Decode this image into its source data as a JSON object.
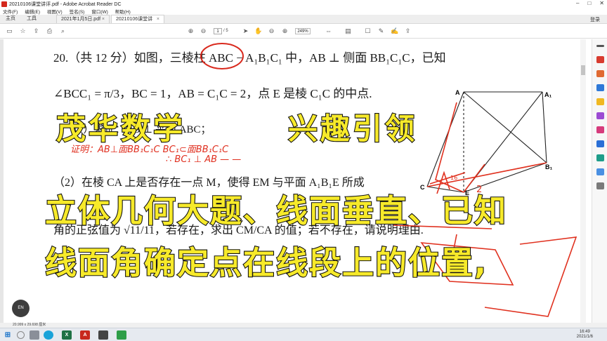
{
  "window": {
    "title": "20210106课堂讲评.pdf - Adobe Acrobat Reader DC",
    "controls": [
      "–",
      "□",
      "✕"
    ]
  },
  "menu": [
    "文件(F)",
    "编辑(E)",
    "视图(V)",
    "签名(S)",
    "窗口(W)",
    "帮助(H)"
  ],
  "tabs": {
    "home": "主页",
    "tools": "工具",
    "doc1": "2021年1月5日.pdf",
    "doc2": "20210106课堂讲评...",
    "close": "×",
    "login": "登录"
  },
  "toolbar": {
    "page_current": "1",
    "page_total": "/ 5",
    "zoom": "249%"
  },
  "problem": {
    "line1": "20.（共 12 分）如图，三棱柱 ABC − A₁B₁C₁ 中，AB ⊥ 侧面 BB₁C₁C，已知",
    "line2": "∠BCC₁ = π/3，BC = 1，AB = C₁C = 2，点 E 是棱 C₁C 的中点.",
    "line3": "（1）求证：AB ⊥ 平面 ABC；",
    "line4": "（2）在棱 CA 上是否存在一点 M，使得 EM 与平面 A₁B₁E 所成",
    "line5": "角的正弦值为 √11/11，若存在，求出 CM/CA 的值；若不存在，请说明理由."
  },
  "annotations": {
    "proof1": "证明：AB⊥面BB₁C₁C  BC₁⊂面BB₁C₁C",
    "proof2": "∴ BC₁ ⊥ AB — —"
  },
  "figure_labels": {
    "A": "A",
    "A1": "A₁",
    "B1": "B₁",
    "C": "C",
    "E": "E",
    "mark2": "2",
    "mark16": "16"
  },
  "overlay": {
    "brand": "茂华数学",
    "slogan": "兴趣引领",
    "line1": "立体几何大题、线面垂直、已知",
    "line2": "线面角确定点在线段上的位置,"
  },
  "status": {
    "page_size": "20.999 x 29.698 厘米"
  },
  "bubble": "EN",
  "taskbar": {
    "time": "16:49",
    "date": "2021/1/6"
  }
}
